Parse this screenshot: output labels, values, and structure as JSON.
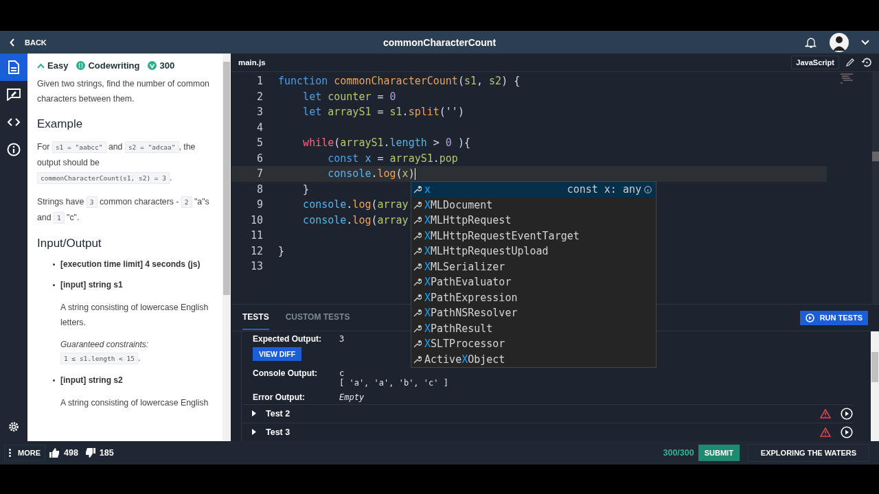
{
  "header": {
    "back": "BACK",
    "title": "commonCharacterCount"
  },
  "sidebar": {
    "items": [
      {
        "selected": true
      },
      {
        "selected": false
      },
      {
        "selected": false
      },
      {
        "selected": false
      }
    ]
  },
  "description": {
    "tags": [
      {
        "kind": "level",
        "label": "Easy"
      },
      {
        "kind": "type",
        "label": "Codewriting"
      },
      {
        "kind": "points",
        "label": "300"
      }
    ],
    "blocks": [
      {
        "kind": "para",
        "segments": [
          {
            "text": "Given two strings, find the number of common characters between them.",
            "code": false
          }
        ]
      },
      {
        "kind": "heading",
        "text": "Example"
      },
      {
        "kind": "para",
        "segments": [
          {
            "text": "For ",
            "code": false
          },
          {
            "text": "s1 = \"aabcc\"",
            "code": true
          },
          {
            "text": " and ",
            "code": false
          },
          {
            "text": "s2 = \"adcaa\"",
            "code": true
          },
          {
            "text": ", the output should be ",
            "code": false
          },
          {
            "text": "commonCharacterCount(s1, s2) = 3",
            "code": true
          },
          {
            "text": ".",
            "code": false
          }
        ]
      },
      {
        "kind": "para",
        "segments": [
          {
            "text": "Strings have ",
            "code": false
          },
          {
            "text": "3",
            "code": true
          },
          {
            "text": " common characters - ",
            "code": false
          },
          {
            "text": "2",
            "code": true
          },
          {
            "text": " \"a\"s and ",
            "code": false
          },
          {
            "text": "1",
            "code": true
          },
          {
            "text": " \"c\".",
            "code": false
          }
        ]
      },
      {
        "kind": "heading",
        "text": "Input/Output"
      },
      {
        "kind": "bullet",
        "text": "[execution time limit] 4 seconds (js)"
      },
      {
        "kind": "bullet",
        "text": "[input] string s1"
      },
      {
        "kind": "sub",
        "segments": [
          {
            "text": "A string consisting of lowercase English letters.",
            "code": false
          }
        ]
      },
      {
        "kind": "note",
        "text": "Guaranteed constraints:"
      },
      {
        "kind": "sub",
        "segments": [
          {
            "text": "1 ≤ s1.length < 15",
            "code": true
          },
          {
            "text": ".",
            "code": false
          }
        ]
      },
      {
        "kind": "bullet",
        "text": "[input] string s2"
      },
      {
        "kind": "sub",
        "segments": [
          {
            "text": "A string consisting of lowercase English",
            "code": false
          }
        ]
      }
    ]
  },
  "editor": {
    "file": "main.js",
    "language": "JavaScript",
    "lines": [
      {
        "number": "1",
        "current": false,
        "tokens": [
          {
            "t": "function ",
            "kind": "keyword"
          },
          {
            "t": "commonCharacterCount",
            "kind": "function"
          },
          {
            "t": "(",
            "kind": "punct"
          },
          {
            "t": "s1",
            "kind": "variable"
          },
          {
            "t": ", ",
            "kind": "punct"
          },
          {
            "t": "s2",
            "kind": "variable"
          },
          {
            "t": ") {",
            "kind": "punct"
          }
        ],
        "children": [
          {
            "number": "2",
            "current": false,
            "tokens": [
              {
                "t": "let ",
                "kind": "keyword"
              },
              {
                "t": "counter",
                "kind": "variable"
              },
              {
                "t": " = ",
                "kind": "punct"
              },
              {
                "t": "0",
                "kind": "number"
              }
            ]
          },
          {
            "number": "3",
            "current": false,
            "tokens": [
              {
                "t": "let ",
                "kind": "keyword"
              },
              {
                "t": "arrayS1",
                "kind": "variable"
              },
              {
                "t": " = ",
                "kind": "punct"
              },
              {
                "t": "s1",
                "kind": "variable"
              },
              {
                "t": ".",
                "kind": "punct"
              },
              {
                "t": "split",
                "kind": "function"
              },
              {
                "t": "('')",
                "kind": "punct"
              }
            ]
          },
          {
            "number": "4",
            "current": false
          },
          {
            "number": "5",
            "current": false,
            "tokens": [
              {
                "t": "while",
                "kind": "control"
              },
              {
                "t": "(",
                "kind": "punct"
              },
              {
                "t": "arrayS1",
                "kind": "variable"
              },
              {
                "t": ".",
                "kind": "punct"
              },
              {
                "t": "length",
                "kind": "property"
              },
              {
                "t": " > ",
                "kind": "punct"
              },
              {
                "t": "0",
                "kind": "number"
              },
              {
                "t": " ){",
                "kind": "punct"
              }
            ],
            "children": [
              {
                "number": "6",
                "current": false,
                "tokens": [
                  {
                    "t": "const ",
                    "kind": "keyword"
                  },
                  {
                    "t": "x",
                    "kind": "property"
                  },
                  {
                    "t": " = ",
                    "kind": "punct"
                  },
                  {
                    "t": "arrayS1",
                    "kind": "variable"
                  },
                  {
                    "t": ".",
                    "kind": "punct"
                  },
                  {
                    "t": "pop",
                    "kind": "variable"
                  }
                ]
              },
              {
                "number": "7",
                "current": true,
                "tokens": [
                  {
                    "t": "console",
                    "kind": "property"
                  },
                  {
                    "t": ".",
                    "kind": "punct"
                  },
                  {
                    "t": "log",
                    "kind": "function"
                  },
                  {
                    "t": "(",
                    "kind": "punct"
                  },
                  {
                    "t": "x",
                    "kind": "variable"
                  },
                  {
                    "t": ")",
                    "kind": "punct"
                  }
                ]
              }
            ]
          },
          {
            "number": "8",
            "current": false,
            "tokens": [
              {
                "t": "}",
                "kind": "punct"
              }
            ]
          },
          {
            "number": "9",
            "current": false,
            "tokens": [
              {
                "t": "console",
                "kind": "property"
              },
              {
                "t": ".",
                "kind": "punct"
              },
              {
                "t": "log",
                "kind": "function"
              },
              {
                "t": "(",
                "kind": "punct"
              },
              {
                "t": "array",
                "kind": "variable"
              }
            ]
          },
          {
            "number": "10",
            "current": false,
            "tokens": [
              {
                "t": "console",
                "kind": "property"
              },
              {
                "t": ".",
                "kind": "punct"
              },
              {
                "t": "log",
                "kind": "function"
              },
              {
                "t": "(",
                "kind": "punct"
              },
              {
                "t": "array",
                "kind": "variable"
              }
            ]
          },
          {
            "number": "11",
            "current": false
          }
        ]
      },
      {
        "number": "12",
        "current": false,
        "tokens": [
          {
            "t": "}",
            "kind": "punct"
          }
        ]
      },
      {
        "number": "13",
        "current": false
      }
    ],
    "suggestions": [
      {
        "match": "x",
        "detail": "const x: any",
        "selected": true
      },
      {
        "match": "X",
        "after": "MLDocument",
        "selected": false
      },
      {
        "match": "X",
        "after": "MLHttpRequest",
        "selected": false
      },
      {
        "match": "X",
        "after": "MLHttpRequestEventTarget",
        "selected": false
      },
      {
        "match": "X",
        "after": "MLHttpRequestUpload",
        "selected": false
      },
      {
        "match": "X",
        "after": "MLSerializer",
        "selected": false
      },
      {
        "match": "X",
        "after": "PathEvaluator",
        "selected": false
      },
      {
        "match": "X",
        "after": "PathExpression",
        "selected": false
      },
      {
        "match": "X",
        "after": "PathNSResolver",
        "selected": false
      },
      {
        "match": "X",
        "after": "PathResult",
        "selected": false
      },
      {
        "match": "X",
        "after": "SLTProcessor",
        "selected": false
      },
      {
        "before": "Active",
        "match": "X",
        "after": "Object",
        "selected": false
      }
    ]
  },
  "tests": {
    "tabs": [
      {
        "label": "TESTS",
        "selected": true
      },
      {
        "label": "CUSTOM TESTS",
        "selected": false
      }
    ],
    "run": "RUN TESTS",
    "expected_label": "Expected Output:",
    "expected": "3",
    "view_diff": "VIEW DIFF",
    "console_label": "Console Output:",
    "console": [
      "c",
      "[ 'a', 'a', 'b', 'c' ]"
    ],
    "error_label": "Error Output:",
    "error": "Empty",
    "items": [
      {
        "label": "Test 2",
        "failed": true
      },
      {
        "label": "Test 3",
        "failed": true
      }
    ]
  },
  "footer": {
    "more": "MORE",
    "likes": "498",
    "dislikes": "185",
    "score": "300/300",
    "submit": "SUBMIT",
    "level": "EXPLORING THE WATERS"
  }
}
